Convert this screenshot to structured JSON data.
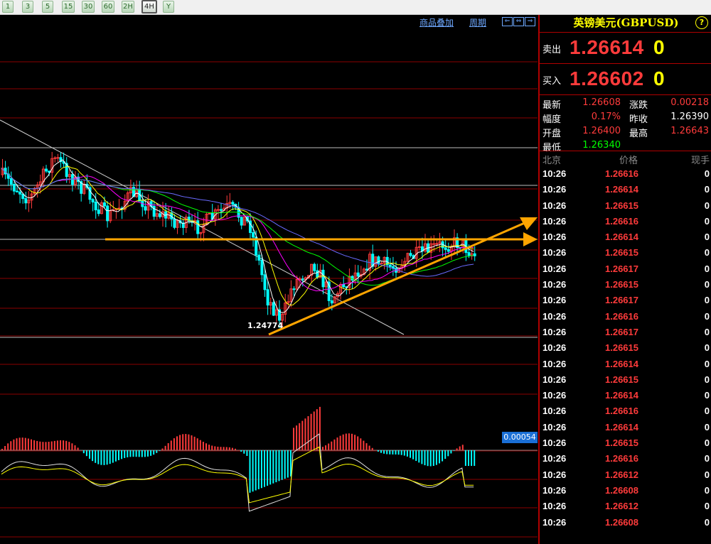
{
  "toolbar": {
    "buttons": [
      {
        "label": "1"
      },
      {
        "label": "3"
      },
      {
        "label": "5"
      },
      {
        "label": "15"
      },
      {
        "label": "30"
      },
      {
        "label": "60"
      },
      {
        "label": "2H"
      },
      {
        "label": "4H"
      },
      {
        "label": "Y"
      }
    ],
    "active": "4H"
  },
  "chart_header": {
    "overlay_label": "商品叠加",
    "period_label": "周期"
  },
  "chart_annotations": {
    "low_price": "1.24774",
    "macd_value": "0.00054"
  },
  "colors": {
    "up": "#ff3b3b",
    "down": "#00ffff",
    "accent": "#ffff00",
    "trendline": "#ffa500",
    "grid": "#8b0000"
  },
  "panel": {
    "title": "英镑美元(GBPUSD)",
    "help_icon": "?",
    "sell_label": "卖出",
    "sell_price": "1.26614",
    "sell_volume": "0",
    "buy_label": "买入",
    "buy_price": "1.26602",
    "buy_volume": "0",
    "stats": {
      "latest_label": "最新",
      "latest_value": "1.26608",
      "change_label": "涨跌",
      "change_value": "0.00218",
      "pct_label": "幅度",
      "pct_value": "0.17%",
      "prev_close_label": "昨收",
      "prev_close_value": "1.26390",
      "open_label": "开盘",
      "open_value": "1.26400",
      "high_label": "最高",
      "high_value": "1.26643",
      "low_label": "最低",
      "low_value": "1.26340"
    },
    "ticks_header": {
      "time": "北京",
      "price": "价格",
      "qty": "现手"
    },
    "ticks": [
      {
        "time": "10:26",
        "price": "1.26616",
        "qty": "0"
      },
      {
        "time": "10:26",
        "price": "1.26614",
        "qty": "0"
      },
      {
        "time": "10:26",
        "price": "1.26615",
        "qty": "0"
      },
      {
        "time": "10:26",
        "price": "1.26616",
        "qty": "0"
      },
      {
        "time": "10:26",
        "price": "1.26614",
        "qty": "0"
      },
      {
        "time": "10:26",
        "price": "1.26615",
        "qty": "0"
      },
      {
        "time": "10:26",
        "price": "1.26617",
        "qty": "0"
      },
      {
        "time": "10:26",
        "price": "1.26615",
        "qty": "0"
      },
      {
        "time": "10:26",
        "price": "1.26617",
        "qty": "0"
      },
      {
        "time": "10:26",
        "price": "1.26616",
        "qty": "0"
      },
      {
        "time": "10:26",
        "price": "1.26617",
        "qty": "0"
      },
      {
        "time": "10:26",
        "price": "1.26615",
        "qty": "0"
      },
      {
        "time": "10:26",
        "price": "1.26614",
        "qty": "0"
      },
      {
        "time": "10:26",
        "price": "1.26615",
        "qty": "0"
      },
      {
        "time": "10:26",
        "price": "1.26614",
        "qty": "0"
      },
      {
        "time": "10:26",
        "price": "1.26616",
        "qty": "0"
      },
      {
        "time": "10:26",
        "price": "1.26614",
        "qty": "0"
      },
      {
        "time": "10:26",
        "price": "1.26615",
        "qty": "0"
      },
      {
        "time": "10:26",
        "price": "1.26616",
        "qty": "0"
      },
      {
        "time": "10:26",
        "price": "1.26612",
        "qty": "0"
      },
      {
        "time": "10:26",
        "price": "1.26608",
        "qty": "0"
      },
      {
        "time": "10:26",
        "price": "1.26612",
        "qty": "0"
      },
      {
        "time": "10:26",
        "price": "1.26608",
        "qty": "0"
      }
    ]
  }
}
